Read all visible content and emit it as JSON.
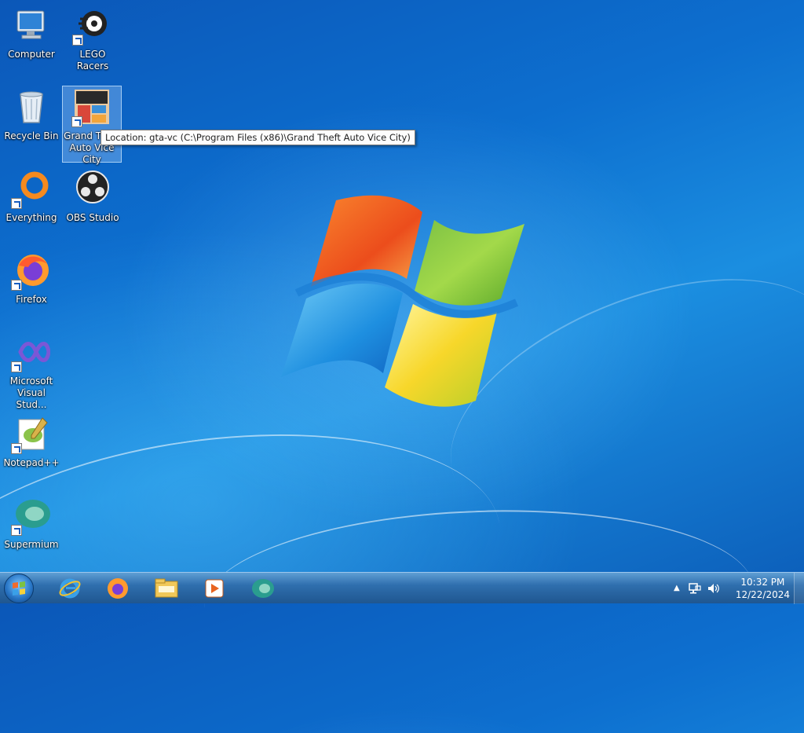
{
  "desktop": {
    "icons": [
      {
        "label": "Computer",
        "icon": "computer-icon"
      },
      {
        "label": "LEGO Racers",
        "icon": "lego-racers-icon"
      },
      {
        "label": "Recycle Bin",
        "icon": "recycle-bin-icon"
      },
      {
        "label": "Grand Theft Auto Vice City",
        "icon": "gta-vice-city-icon"
      },
      {
        "label": "Everything",
        "icon": "everything-search-icon"
      },
      {
        "label": "OBS Studio",
        "icon": "obs-studio-icon"
      },
      {
        "label": "Firefox",
        "icon": "firefox-icon"
      },
      {
        "label": "Microsoft Visual Stud...",
        "icon": "visual-studio-icon"
      },
      {
        "label": "Notepad++",
        "icon": "notepad-plus-plus-icon"
      },
      {
        "label": "Supermium",
        "icon": "supermium-icon"
      }
    ],
    "tooltip": "Location: gta-vc (C:\\Program Files (x86)\\Grand Theft Auto Vice City)"
  },
  "taskbar": {
    "pinned": [
      "internet-explorer-icon",
      "firefox-icon",
      "file-explorer-icon",
      "media-player-icon",
      "supermium-icon"
    ],
    "tray": {
      "time": "10:32 PM",
      "date": "12/22/2024"
    }
  },
  "colors": {
    "desktop_blue": "#0d6fcf",
    "taskbar": "#2f6fae"
  }
}
